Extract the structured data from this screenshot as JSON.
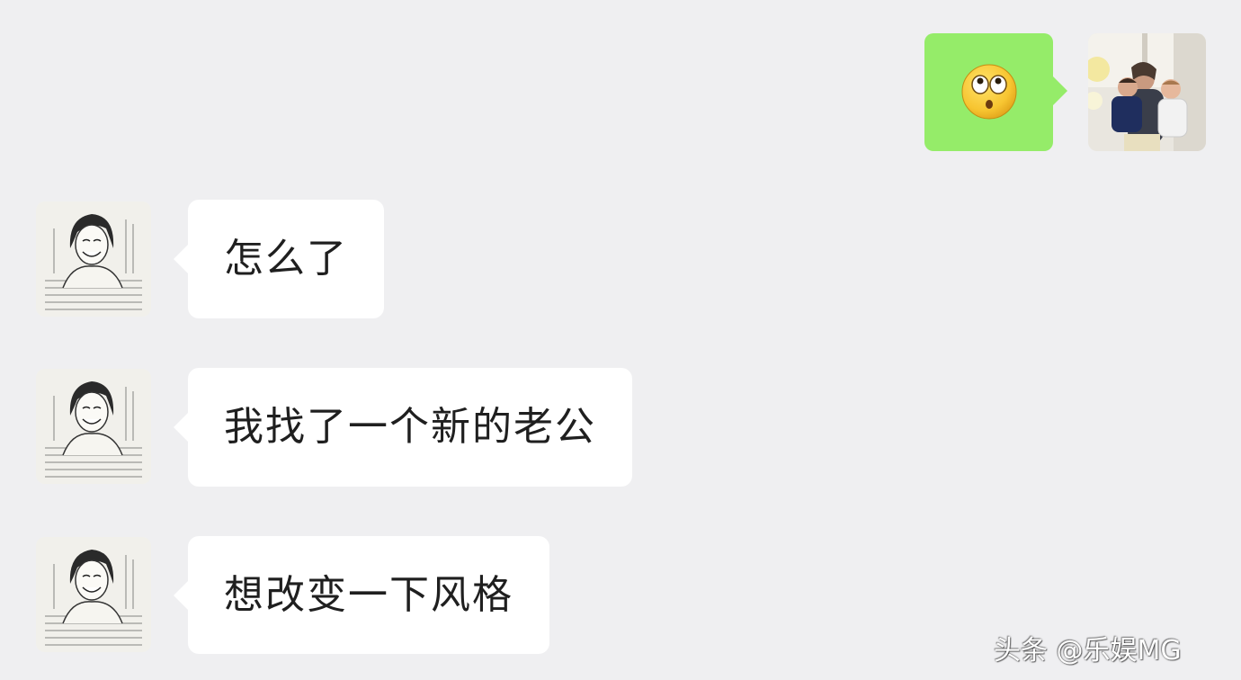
{
  "chat": {
    "background_color": "#efeff1",
    "outgoing": {
      "emoji_icon": "flushed-face-emoji-icon",
      "bubble_color": "#95ec69",
      "avatar": "family-photo-avatar"
    },
    "incoming": [
      {
        "text": "怎么了",
        "avatar": "sketch-portrait-avatar"
      },
      {
        "text": "我找了一个新的老公",
        "avatar": "sketch-portrait-avatar"
      },
      {
        "text": "想改变一下风格",
        "avatar": "sketch-portrait-avatar"
      }
    ]
  },
  "watermark": {
    "text": "头条 @乐娱MG"
  }
}
